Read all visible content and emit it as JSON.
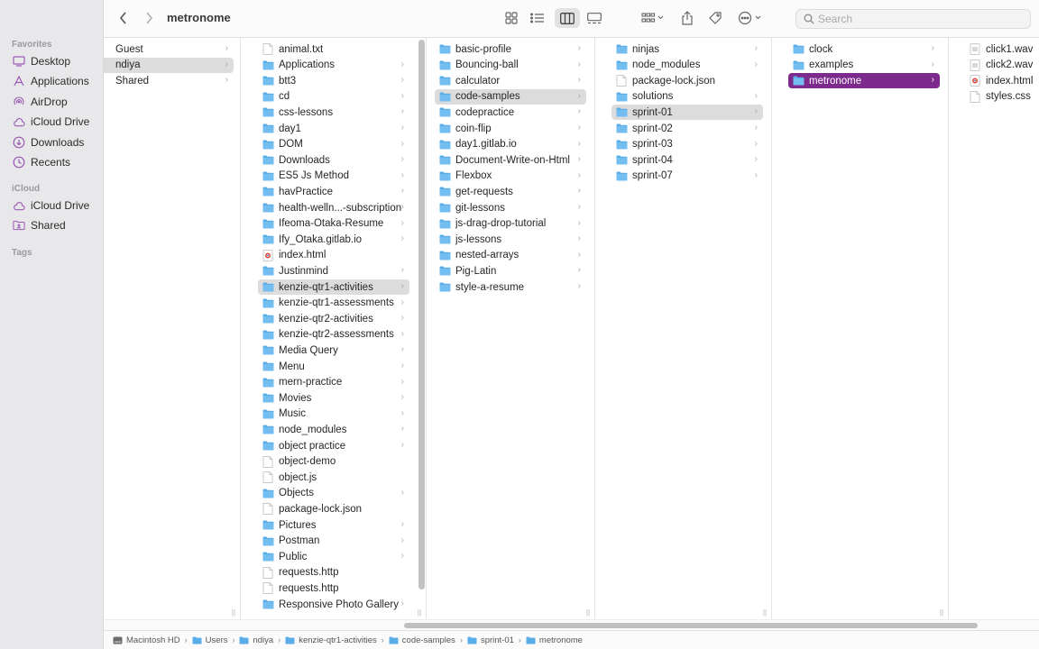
{
  "window": {
    "title": "metronome"
  },
  "toolbar": {
    "search_placeholder": "Search",
    "icons": [
      "back-icon",
      "forward-icon",
      "icon-view-icon",
      "list-view-icon",
      "column-view-icon",
      "gallery-view-icon",
      "group-icon",
      "share-icon",
      "tag-icon",
      "more-icon",
      "search-icon"
    ]
  },
  "colors": {
    "accent": "#7c2a8c",
    "folder": "#5aaee8",
    "selection_gray": "#dcdcdc"
  },
  "sidebar": {
    "favorites_label": "Favorites",
    "favorites": [
      {
        "label": "Desktop",
        "icon": "desktop-icon"
      },
      {
        "label": "Applications",
        "icon": "applications-icon"
      },
      {
        "label": "AirDrop",
        "icon": "airdrop-icon"
      },
      {
        "label": "iCloud Drive",
        "icon": "icloud-icon"
      },
      {
        "label": "Downloads",
        "icon": "downloads-icon"
      },
      {
        "label": "Recents",
        "icon": "recents-icon"
      }
    ],
    "icloud_label": "iCloud",
    "icloud": [
      {
        "label": "iCloud Drive",
        "icon": "icloud-icon"
      },
      {
        "label": "Shared",
        "icon": "shared-folder-icon"
      }
    ],
    "tags_label": "Tags"
  },
  "columns": [
    {
      "items": [
        {
          "name": "Guest",
          "type": "folder-plain",
          "chevron": true
        },
        {
          "name": "ndiya",
          "type": "folder-plain",
          "chevron": true,
          "selected": "gray"
        },
        {
          "name": "Shared",
          "type": "folder-plain",
          "chevron": true
        }
      ]
    },
    {
      "items": [
        {
          "name": "animal.txt",
          "type": "file",
          "chevron": false
        },
        {
          "name": "Applications",
          "type": "folder",
          "chevron": true
        },
        {
          "name": "btt3",
          "type": "folder",
          "chevron": true
        },
        {
          "name": "cd",
          "type": "folder",
          "chevron": true
        },
        {
          "name": "css-lessons",
          "type": "folder",
          "chevron": true
        },
        {
          "name": "day1",
          "type": "folder",
          "chevron": true
        },
        {
          "name": "DOM",
          "type": "folder",
          "chevron": true
        },
        {
          "name": "Downloads",
          "type": "folder",
          "chevron": true
        },
        {
          "name": "ES5 Js Method",
          "type": "folder",
          "chevron": true
        },
        {
          "name": "havPractice",
          "type": "folder",
          "chevron": true
        },
        {
          "name": "health-welln...-subscription",
          "type": "folder",
          "chevron": true
        },
        {
          "name": "Ifeoma-Otaka-Resume",
          "type": "folder",
          "chevron": true
        },
        {
          "name": "Ify_Otaka.gitlab.io",
          "type": "folder",
          "chevron": true
        },
        {
          "name": "index.html",
          "type": "html",
          "chevron": false
        },
        {
          "name": "Justinmind",
          "type": "folder",
          "chevron": true
        },
        {
          "name": "kenzie-qtr1-activities",
          "type": "folder",
          "chevron": true,
          "selected": "gray"
        },
        {
          "name": "kenzie-qtr1-assessments",
          "type": "folder",
          "chevron": true
        },
        {
          "name": "kenzie-qtr2-activities",
          "type": "folder",
          "chevron": true
        },
        {
          "name": "kenzie-qtr2-assessments",
          "type": "folder",
          "chevron": true
        },
        {
          "name": "Media Query",
          "type": "folder",
          "chevron": true
        },
        {
          "name": "Menu",
          "type": "folder",
          "chevron": true
        },
        {
          "name": "mern-practice",
          "type": "folder",
          "chevron": true
        },
        {
          "name": "Movies",
          "type": "folder",
          "chevron": true
        },
        {
          "name": "Music",
          "type": "folder",
          "chevron": true
        },
        {
          "name": "node_modules",
          "type": "folder",
          "chevron": true
        },
        {
          "name": "object practice",
          "type": "folder",
          "chevron": true
        },
        {
          "name": "object-demo",
          "type": "file",
          "chevron": false
        },
        {
          "name": "object.js",
          "type": "file",
          "chevron": false
        },
        {
          "name": "Objects",
          "type": "folder",
          "chevron": true
        },
        {
          "name": "package-lock.json",
          "type": "file",
          "chevron": false
        },
        {
          "name": "Pictures",
          "type": "folder",
          "chevron": true
        },
        {
          "name": "Postman",
          "type": "folder",
          "chevron": true
        },
        {
          "name": "Public",
          "type": "folder",
          "chevron": true
        },
        {
          "name": "requests.http",
          "type": "file",
          "chevron": false
        },
        {
          "name": "requests.http",
          "type": "file",
          "chevron": false
        },
        {
          "name": "Responsive Photo Gallery",
          "type": "folder",
          "chevron": true
        }
      ]
    },
    {
      "items": [
        {
          "name": "basic-profile",
          "type": "folder",
          "chevron": true
        },
        {
          "name": "Bouncing-ball",
          "type": "folder",
          "chevron": true
        },
        {
          "name": "calculator",
          "type": "folder",
          "chevron": true
        },
        {
          "name": "code-samples",
          "type": "folder",
          "chevron": true,
          "selected": "gray"
        },
        {
          "name": "codepractice",
          "type": "folder",
          "chevron": true
        },
        {
          "name": "coin-flip",
          "type": "folder",
          "chevron": true
        },
        {
          "name": "day1.gitlab.io",
          "type": "folder",
          "chevron": true
        },
        {
          "name": "Document-Write-on-Html",
          "type": "folder",
          "chevron": true
        },
        {
          "name": "Flexbox",
          "type": "folder",
          "chevron": true
        },
        {
          "name": "get-requests",
          "type": "folder",
          "chevron": true
        },
        {
          "name": "git-lessons",
          "type": "folder",
          "chevron": true
        },
        {
          "name": "js-drag-drop-tutorial",
          "type": "folder",
          "chevron": true
        },
        {
          "name": "js-lessons",
          "type": "folder",
          "chevron": true
        },
        {
          "name": "nested-arrays",
          "type": "folder",
          "chevron": true
        },
        {
          "name": "Pig-Latin",
          "type": "folder",
          "chevron": true
        },
        {
          "name": "style-a-resume",
          "type": "folder",
          "chevron": true
        }
      ]
    },
    {
      "items": [
        {
          "name": "ninjas",
          "type": "folder",
          "chevron": true
        },
        {
          "name": "node_modules",
          "type": "folder",
          "chevron": true
        },
        {
          "name": "package-lock.json",
          "type": "file",
          "chevron": false
        },
        {
          "name": "solutions",
          "type": "folder",
          "chevron": true
        },
        {
          "name": "sprint-01",
          "type": "folder",
          "chevron": true,
          "selected": "gray"
        },
        {
          "name": "sprint-02",
          "type": "folder",
          "chevron": true
        },
        {
          "name": "sprint-03",
          "type": "folder",
          "chevron": true
        },
        {
          "name": "sprint-04",
          "type": "folder",
          "chevron": true
        },
        {
          "name": "sprint-07",
          "type": "folder",
          "chevron": true
        }
      ]
    },
    {
      "items": [
        {
          "name": "clock",
          "type": "folder",
          "chevron": true
        },
        {
          "name": "examples",
          "type": "folder",
          "chevron": true
        },
        {
          "name": "metronome",
          "type": "folder",
          "chevron": true,
          "selected": "purple"
        }
      ]
    },
    {
      "items": [
        {
          "name": "click1.wav",
          "type": "audio",
          "chevron": false
        },
        {
          "name": "click2.wav",
          "type": "audio",
          "chevron": false
        },
        {
          "name": "index.html",
          "type": "html",
          "chevron": false
        },
        {
          "name": "styles.css",
          "type": "file",
          "chevron": false
        }
      ]
    }
  ],
  "pathbar": [
    {
      "label": "Macintosh HD",
      "icon": "hard-drive-icon"
    },
    {
      "label": "Users",
      "icon": "folder-icon"
    },
    {
      "label": "ndiya",
      "icon": "folder-icon"
    },
    {
      "label": "kenzie-qtr1-activities",
      "icon": "folder-icon"
    },
    {
      "label": "code-samples",
      "icon": "folder-icon"
    },
    {
      "label": "sprint-01",
      "icon": "folder-icon"
    },
    {
      "label": "metronome",
      "icon": "folder-icon"
    }
  ]
}
